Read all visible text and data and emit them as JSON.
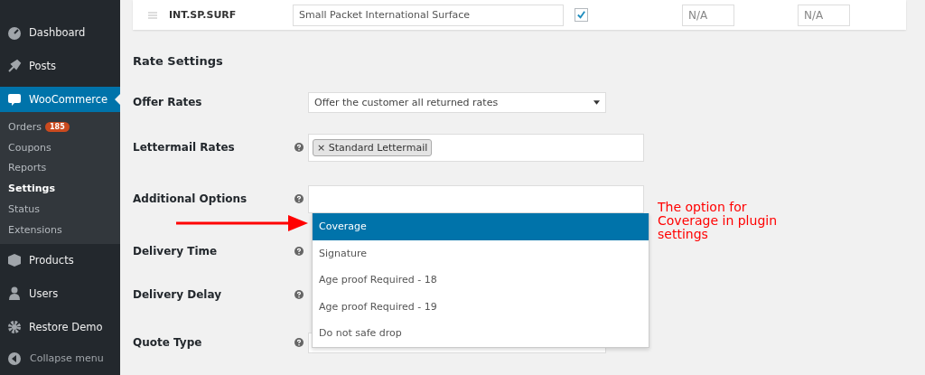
{
  "sidebar": {
    "items": [
      {
        "label": "Dashboard",
        "selected": false
      },
      {
        "label": "Posts",
        "selected": false
      },
      {
        "label": "WooCommerce",
        "selected": true,
        "children": [
          {
            "label": "Orders",
            "badge": "185",
            "selected": false
          },
          {
            "label": "Coupons",
            "selected": false
          },
          {
            "label": "Reports",
            "selected": false
          },
          {
            "label": "Settings",
            "selected": true
          },
          {
            "label": "Status",
            "selected": false
          },
          {
            "label": "Extensions",
            "selected": false
          }
        ]
      },
      {
        "label": "Products",
        "selected": false
      },
      {
        "label": "Users",
        "selected": false
      },
      {
        "label": "Restore Demo",
        "selected": false
      }
    ],
    "collapse": "Collapse menu"
  },
  "shipping_row": {
    "code": "INT.SP.SURF",
    "name": "Small Packet International Surface",
    "enabled": true,
    "column_4": "N/A",
    "column_5": "N/A"
  },
  "section_title": "Rate Settings",
  "fields": [
    {
      "label": "Offer Rates",
      "kind": "select",
      "help": false,
      "value": "Offer the customer all returned rates"
    },
    {
      "label": "Lettermail Rates",
      "kind": "tags",
      "help": true,
      "tags": [
        {
          "label": "Standard Lettermail",
          "remove": "×"
        }
      ]
    },
    {
      "label": "Additional Options",
      "kind": "multiselect",
      "help": true
    },
    {
      "label": "Delivery Time",
      "kind": "none",
      "help": true
    },
    {
      "label": "Delivery Delay",
      "kind": "none",
      "help": true
    },
    {
      "label": "Quote Type",
      "kind": "select",
      "help": true
    }
  ],
  "dropdown": {
    "options": [
      {
        "label": "Coverage",
        "selected": true
      },
      {
        "label": "Signature",
        "selected": false
      },
      {
        "label": "Age proof Required - 18",
        "selected": false
      },
      {
        "label": "Age proof Required - 19",
        "selected": false
      },
      {
        "label": "Do not safe drop",
        "selected": false
      }
    ]
  },
  "annotation": "The option for Coverage in plugin settings"
}
